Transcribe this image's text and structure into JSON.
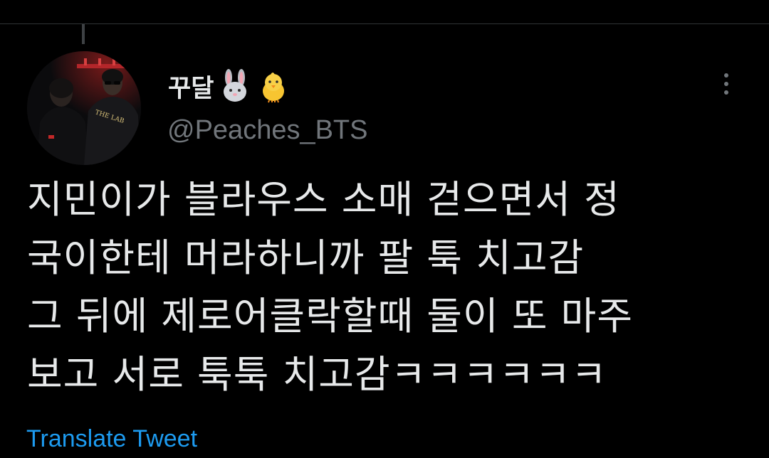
{
  "tweet": {
    "author": {
      "display_name": "꾸달",
      "emoji": [
        "rabbit-face",
        "baby-chick"
      ],
      "handle": "@Peaches_BTS",
      "avatar_shirt_text": "THE LAB"
    },
    "text_lines": [
      "지민이가 블라우스 소매 걷으면서 정",
      "국이한테 머라하니까 팔 툭 치고감",
      "그 뒤에 제로어클락할때 둘이 또 마주",
      "보고 서로 툭툭 치고감ㅋㅋㅋㅋㅋㅋ"
    ],
    "translate_label": "Translate Tweet"
  },
  "colors": {
    "background": "#000000",
    "text_primary": "#e7e9ea",
    "text_secondary": "#71767b",
    "link": "#1d9bf0",
    "divider": "#2f3336"
  },
  "icons": {
    "more": "more-horizontal-icon"
  }
}
